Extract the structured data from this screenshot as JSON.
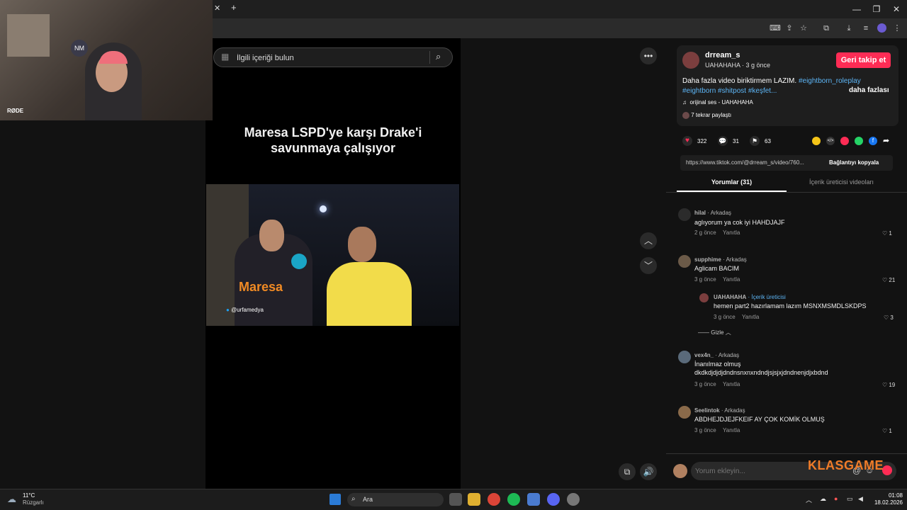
{
  "webcam": {
    "overlay_text": "RØDE"
  },
  "search": {
    "placeholder": "İlgili içeriği bulun"
  },
  "video": {
    "caption_line1": "Maresa LSPD'ye karşı Drake'i",
    "caption_line2": "savunmaya çalışıyor",
    "overlay_name": "Maresa",
    "overlay_handle": "@urfamedya"
  },
  "post": {
    "username": "drream_s",
    "subline": "UAHAHAHA · 3 g önce",
    "follow_label": "Geri takip et",
    "description_line1": "Daha fazla video biriktirmem LAZIM.",
    "hashtag1": "#eightborn_roleplay",
    "hashtag2": "#eightborn #shitpost #keşfet...",
    "more_label": "daha fazlası",
    "sound": "orijinal ses - UAHAHAHA",
    "reposts": "7 tekrar paylaştı",
    "likes": "322",
    "comments": "31",
    "saves": "63",
    "link": "https://www.tiktok.com/@drream_s/video/760...",
    "copy_link_label": "Bağlantıyı kopyala"
  },
  "tabs": {
    "comments": "Yorumlar (31)",
    "creator_videos": "İçerik üreticisi videoları"
  },
  "comments": [
    {
      "name": "hilal",
      "relation": "· Arkadaş",
      "text": "aglıyorum ya cok iyi HAHDJAJF",
      "time": "2 g önce",
      "reply": "Yanıtla",
      "likes": "1"
    },
    {
      "name": "supphime",
      "relation": "· Arkadaş",
      "text": "Aglicam BACIM",
      "time": "3 g önce",
      "reply": "Yanıtla",
      "likes": "21"
    },
    {
      "name": "vex4n_",
      "relation": "· Arkadaş",
      "text": "İnanılmaz olmuş",
      "text2": "dkdkdjdjdjdndnsnxnxndndjsjsjxjdndnenjdjxbdnd",
      "time": "3 g önce",
      "reply": "Yanıtla",
      "likes": "19"
    },
    {
      "name": "Seelintok",
      "relation": "· Arkadaş",
      "text": "ABDHEJDJEJFKEIF AY ÇOK KOMİK OLMUŞ",
      "time": "3 g önce",
      "reply": "Yanıtla",
      "likes": "1"
    }
  ],
  "reply": {
    "name": "UAHAHAHA",
    "badge": "· İçerik üreticisi",
    "text": "hemen part2 hazırlamam lazım MSNXMSMDLSKDPS",
    "time": "3 g önce",
    "reply": "Yanıtla",
    "likes": "3",
    "hide": "Gizle"
  },
  "comment_input": {
    "placeholder": "Yorum ekleyin..."
  },
  "watermark": "KLASGAME",
  "taskbar": {
    "weather_temp": "11°C",
    "weather_label": "Rüzgarlı",
    "search": "Ara",
    "time": "01:08",
    "date": "18.02.2026"
  },
  "colors": {
    "accent": "#fe2c55",
    "link": "#5db5f5",
    "watermark": "#f07c28"
  }
}
